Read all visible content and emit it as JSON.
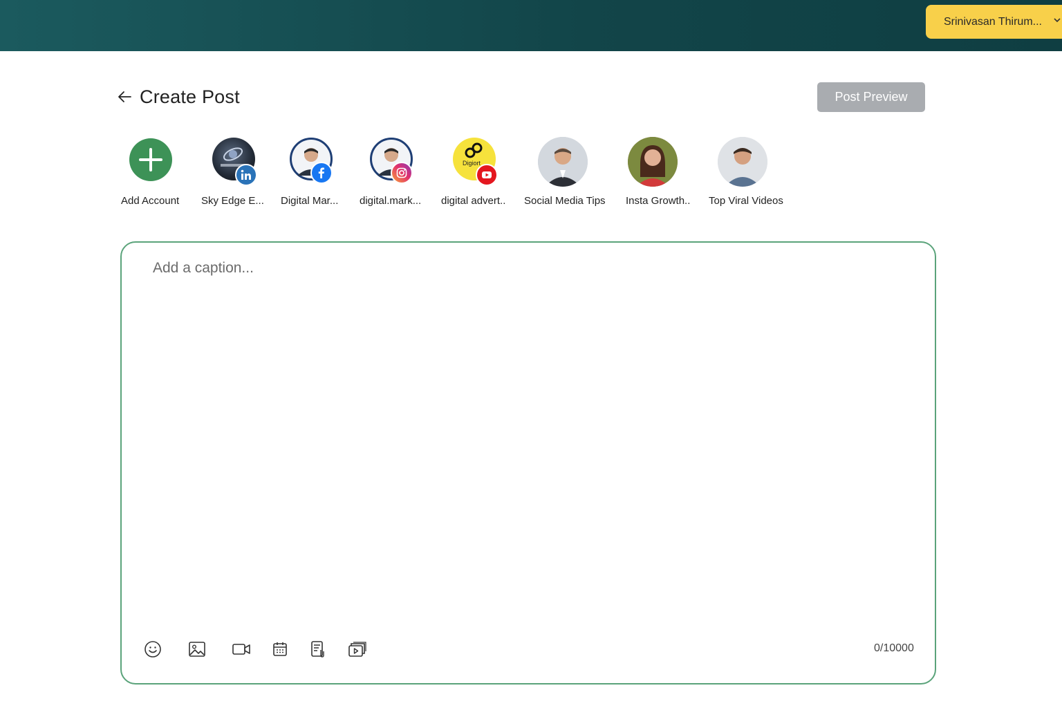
{
  "topbar": {
    "user_name": "Srinivasan Thirum...",
    "colors": {
      "bar": "#134a4e",
      "user_menu": "#f8d04a"
    }
  },
  "header": {
    "title": "Create Post",
    "preview_label": "Post Preview"
  },
  "accounts": [
    {
      "label": "Add Account",
      "icon": "plus-icon"
    },
    {
      "label": "Sky Edge E...",
      "network": "linkedin"
    },
    {
      "label": "Digital Mar...",
      "network": "facebook"
    },
    {
      "label": "digital.mark...",
      "network": "instagram"
    },
    {
      "label": "digital advert..",
      "network": "youtube",
      "logo_text": "Digiort"
    },
    {
      "label": "Social Media Tips"
    },
    {
      "label": "Insta Growth.."
    },
    {
      "label": "Top Viral Videos"
    }
  ],
  "composer": {
    "caption_placeholder": "Add a caption...",
    "caption_value": "",
    "counter": "0/10000",
    "tools": [
      "emoji-icon",
      "image-icon",
      "video-icon",
      "schedule-icon",
      "template-icon",
      "carousel-icon"
    ],
    "border_color": "#5aa37a"
  }
}
